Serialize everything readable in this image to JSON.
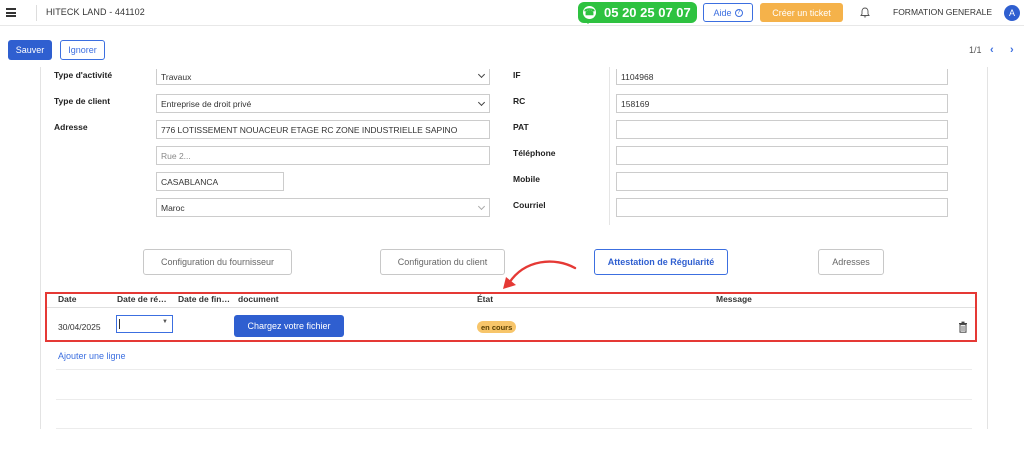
{
  "topbar": {
    "company": "HITECK LAND - 441102",
    "phone": "05 20 25 07 07",
    "help_label": "Aide",
    "ticket_label": "Créer un ticket",
    "user_name": "FORMATION GENERALE",
    "avatar_letter": "A",
    "colors": {
      "phone": "#2ec240",
      "ticket": "#f5b24a",
      "primary": "#2f5fd0"
    }
  },
  "actions": {
    "save_label": "Sauver",
    "ignore_label": "Ignorer",
    "pager": "1/1"
  },
  "form": {
    "left": {
      "activity_label": "Type d'activité",
      "activity_value": "Travaux",
      "client_type_label": "Type de client",
      "client_type_value": "Entreprise de droit privé",
      "address_label": "Adresse",
      "address_line1": "776 LOTISSEMENT NOUACEUR ETAGE RC ZONE INDUSTRIELLE SAPINO",
      "address_line2_placeholder": "Rue 2...",
      "city": "CASABLANCA",
      "country": "Maroc"
    },
    "right": {
      "if_label": "IF",
      "if_value": "1104968",
      "rc_label": "RC",
      "rc_value": "158169",
      "pat_label": "PAT",
      "pat_value": "",
      "phone_label": "Téléphone",
      "phone_value": "",
      "mobile_label": "Mobile",
      "mobile_value": "",
      "email_label": "Courriel",
      "email_value": ""
    }
  },
  "tabs": [
    {
      "label": "Configuration du fournisseur",
      "active": false
    },
    {
      "label": "Configuration du client",
      "active": false
    },
    {
      "label": "Attestation de Régularité",
      "active": true
    },
    {
      "label": "Adresses",
      "active": false
    }
  ],
  "table": {
    "columns": [
      "Date",
      "Date de ré…",
      "Date de fin…",
      "document",
      "État",
      "Message"
    ],
    "rows": [
      {
        "date": "30/04/2025",
        "upload_label": "Chargez votre fichier",
        "status": "en cours"
      }
    ],
    "add_line_label": "Ajouter une ligne"
  }
}
